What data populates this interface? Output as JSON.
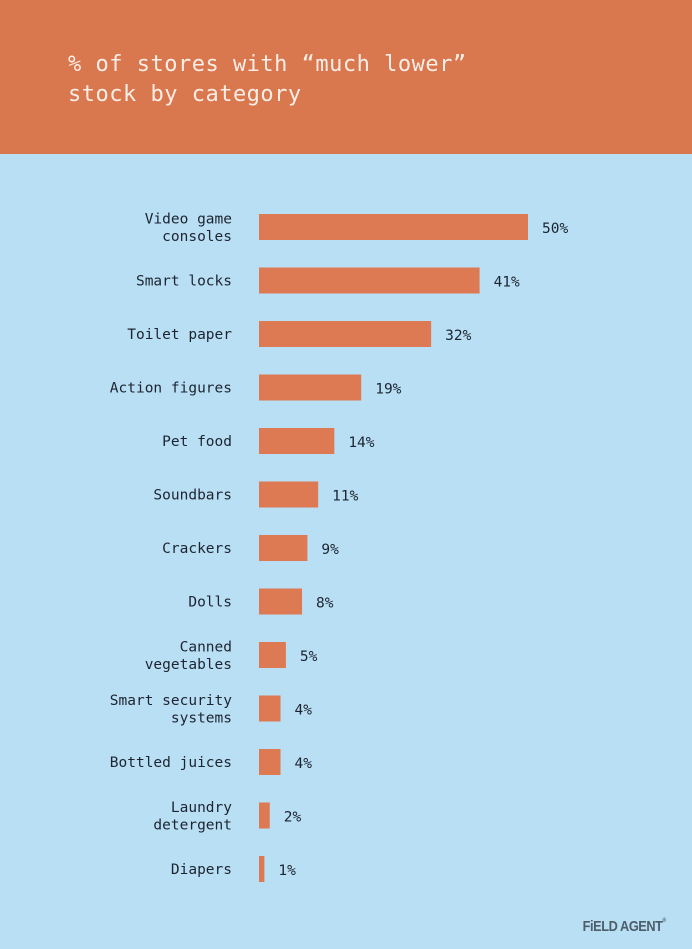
{
  "header": {
    "title": "% of stores with “much lower”\nstock by category"
  },
  "colors": {
    "header_bg": "#d9774f",
    "bar": "#dd7a53",
    "background": "#b9dff4",
    "text": "#1d2430"
  },
  "brand": {
    "logo_text": "FiELD AGENT",
    "logo_mark": "®"
  },
  "chart_data": {
    "type": "bar",
    "orientation": "horizontal",
    "title": "% of stores with “much lower” stock by category",
    "xlabel": "",
    "ylabel": "",
    "xlim": [
      0,
      50
    ],
    "grid": false,
    "legend": "none",
    "categories": [
      [
        "Video game",
        "consoles"
      ],
      [
        "Smart locks"
      ],
      [
        "Toilet paper"
      ],
      [
        "Action figures"
      ],
      [
        "Pet food"
      ],
      [
        "Soundbars"
      ],
      [
        "Crackers"
      ],
      [
        "Dolls"
      ],
      [
        "Canned",
        "vegetables"
      ],
      [
        "Smart security",
        "systems"
      ],
      [
        "Bottled juices"
      ],
      [
        "Laundry",
        "detergent"
      ],
      [
        "Diapers"
      ]
    ],
    "values": [
      50,
      41,
      32,
      19,
      14,
      11,
      9,
      8,
      5,
      4,
      4,
      2,
      1
    ],
    "value_labels": [
      "50%",
      "41%",
      "32%",
      "19%",
      "14%",
      "11%",
      "9%",
      "8%",
      "5%",
      "4%",
      "4%",
      "2%",
      "1%"
    ]
  }
}
